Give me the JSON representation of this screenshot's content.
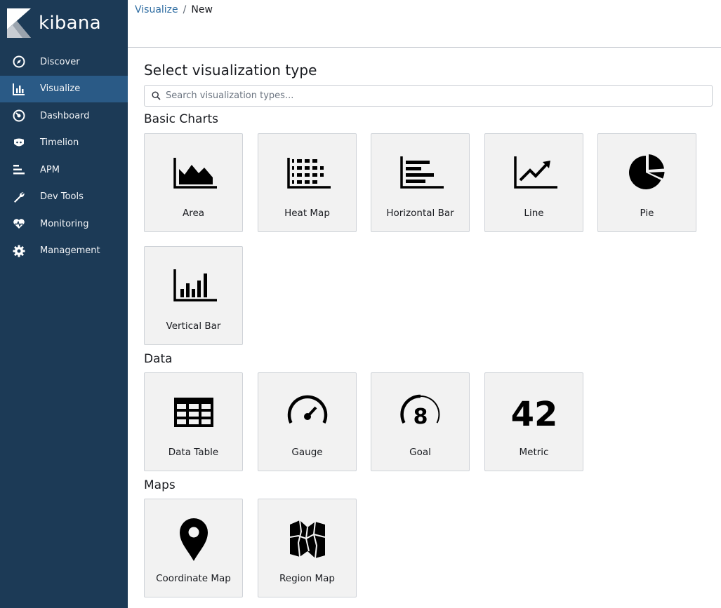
{
  "app": {
    "logo_text": "kibana"
  },
  "sidebar": {
    "items": [
      {
        "label": "Discover",
        "icon": "compass-icon"
      },
      {
        "label": "Visualize",
        "icon": "bar-chart-icon",
        "active": true
      },
      {
        "label": "Dashboard",
        "icon": "dashboard-icon"
      },
      {
        "label": "Timelion",
        "icon": "timelion-icon"
      },
      {
        "label": "APM",
        "icon": "apm-icon"
      },
      {
        "label": "Dev Tools",
        "icon": "wrench-icon"
      },
      {
        "label": "Monitoring",
        "icon": "heartbeat-icon"
      },
      {
        "label": "Management",
        "icon": "gear-icon"
      }
    ]
  },
  "breadcrumb": {
    "parent": "Visualize",
    "separator": "/",
    "current": "New"
  },
  "main": {
    "title": "Select visualization type",
    "search": {
      "placeholder": "Search visualization types...",
      "value": ""
    },
    "sections": [
      {
        "title": "Basic Charts",
        "tiles": [
          {
            "label": "Area",
            "icon": "area-chart-icon"
          },
          {
            "label": "Heat Map",
            "icon": "heat-map-icon"
          },
          {
            "label": "Horizontal Bar",
            "icon": "horizontal-bar-icon"
          },
          {
            "label": "Line",
            "icon": "line-chart-icon"
          },
          {
            "label": "Pie",
            "icon": "pie-chart-icon"
          },
          {
            "label": "Vertical Bar",
            "icon": "vertical-bar-icon"
          }
        ]
      },
      {
        "title": "Data",
        "tiles": [
          {
            "label": "Data Table",
            "icon": "table-icon"
          },
          {
            "label": "Gauge",
            "icon": "gauge-icon"
          },
          {
            "label": "Goal",
            "icon": "goal-icon",
            "icon_text": "8"
          },
          {
            "label": "Metric",
            "icon": "metric-icon",
            "icon_text": "42"
          }
        ]
      },
      {
        "title": "Maps",
        "tiles": [
          {
            "label": "Coordinate Map",
            "icon": "map-marker-icon"
          },
          {
            "label": "Region Map",
            "icon": "region-map-icon"
          }
        ]
      }
    ]
  },
  "colors": {
    "sidebar_bg": "#1c3a56",
    "sidebar_active": "#2a5a86",
    "link": "#2f6da2",
    "tile_bg": "#f2f2f2"
  }
}
